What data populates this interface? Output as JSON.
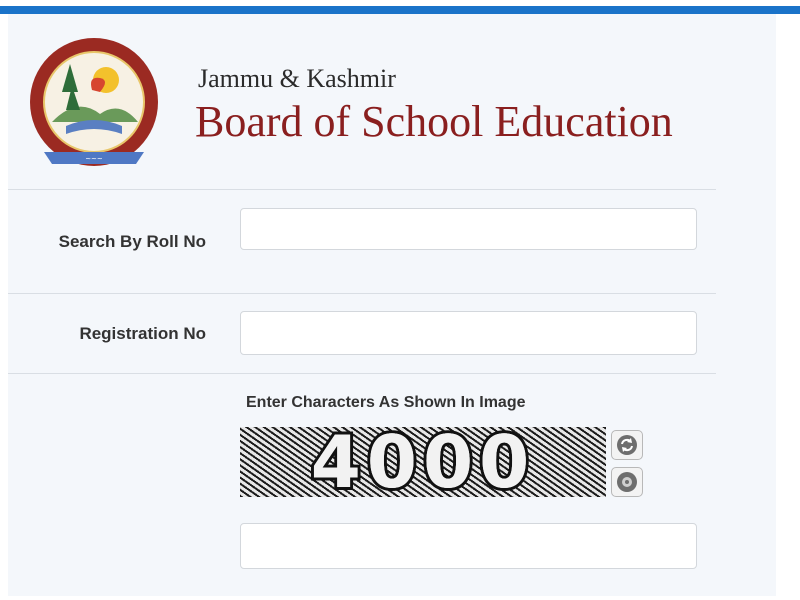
{
  "header": {
    "subtitle": "Jammu & Kashmir",
    "title": "Board of School Education",
    "logo_icon": "jkbose-emblem-icon"
  },
  "form": {
    "roll_label": "Search By Roll No",
    "roll_value": "",
    "registration_label": "Registration No",
    "registration_value": "",
    "captcha_label": "Enter Characters As Shown In Image",
    "captcha_text": "4000",
    "captcha_value": "",
    "refresh_icon": "refresh-icon",
    "audio_icon": "audio-icon"
  },
  "colors": {
    "accent": "#1a73c9",
    "title": "#8a1f1f",
    "panel": "#f4f7fb"
  }
}
